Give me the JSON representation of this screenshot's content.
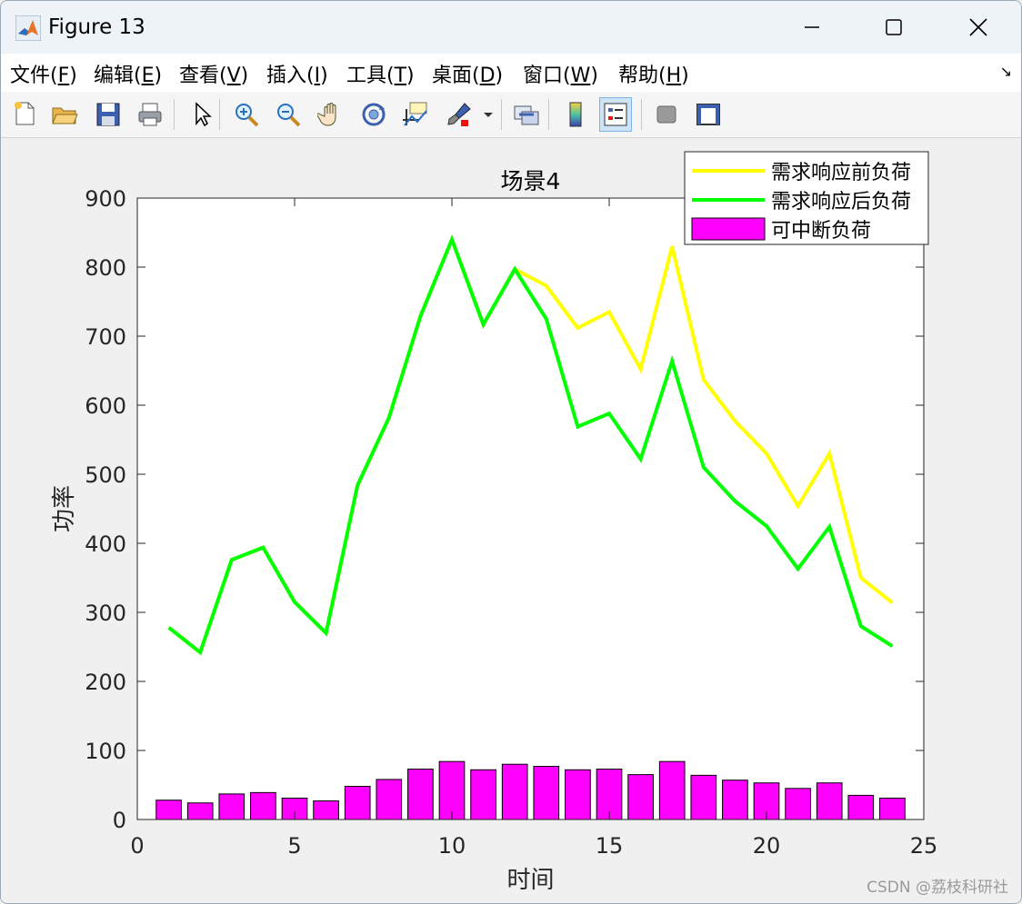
{
  "window": {
    "title": "Figure 13",
    "minimize_label": "—",
    "maximize_label": "☐",
    "close_label": "✕"
  },
  "menu": [
    {
      "label": "文件(",
      "key": "F",
      "tail": ")"
    },
    {
      "label": "编辑(",
      "key": "E",
      "tail": ")"
    },
    {
      "label": "查看(",
      "key": "V",
      "tail": ")"
    },
    {
      "label": "插入(",
      "key": "I",
      "tail": ")"
    },
    {
      "label": "工具(",
      "key": "T",
      "tail": ")"
    },
    {
      "label": "桌面(",
      "key": "D",
      "tail": ")"
    },
    {
      "label": "窗口(",
      "key": "W",
      "tail": ")"
    },
    {
      "label": "帮助(",
      "key": "H",
      "tail": ")"
    }
  ],
  "toolbar": {
    "icons": [
      "new-file-icon",
      "open-folder-icon",
      "save-icon",
      "print-icon",
      "pointer-icon",
      "zoom-in-icon",
      "zoom-out-icon",
      "pan-hand-icon",
      "rotate-3d-icon",
      "data-cursor-icon",
      "brush-icon",
      "link-plot-icon",
      "colorbar-icon",
      "legend-icon",
      "hide-plot-tools-icon",
      "show-plot-tools-icon"
    ]
  },
  "watermark": "CSDN @荔枝科研社",
  "colors": {
    "before": "#ffff00",
    "after": "#00ff00",
    "bar": "#ff00ff"
  },
  "chart_data": {
    "type": "line+bar",
    "title": "场景4",
    "xlabel": "时间",
    "ylabel": "功率",
    "xlim": [
      0,
      25
    ],
    "ylim": [
      0,
      900
    ],
    "xticks": [
      0,
      5,
      10,
      15,
      20,
      25
    ],
    "yticks": [
      0,
      100,
      200,
      300,
      400,
      500,
      600,
      700,
      800,
      900
    ],
    "x": [
      1,
      2,
      3,
      4,
      5,
      6,
      7,
      8,
      9,
      10,
      11,
      12,
      13,
      14,
      15,
      16,
      17,
      18,
      19,
      20,
      21,
      22,
      23,
      24
    ],
    "legend_position": "top-right",
    "series": [
      {
        "name": "需求响应前负荷",
        "kind": "line",
        "color": "#ffff00",
        "values": [
          278,
          242,
          376,
          394,
          315,
          270,
          484,
          582,
          729,
          840,
          717,
          797,
          773,
          712,
          735,
          652,
          830,
          637,
          577,
          530,
          454,
          530,
          350,
          314
        ]
      },
      {
        "name": "需求响应后负荷",
        "kind": "line",
        "color": "#00ff00",
        "values": [
          278,
          242,
          376,
          394,
          315,
          270,
          484,
          582,
          729,
          840,
          717,
          797,
          725,
          569,
          588,
          522,
          664,
          510,
          461,
          425,
          363,
          424,
          280,
          251
        ]
      },
      {
        "name": "可中断负荷",
        "kind": "bar",
        "color": "#ff00ff",
        "values": [
          28,
          24,
          37,
          39,
          31,
          27,
          48,
          58,
          73,
          84,
          72,
          80,
          77,
          72,
          73,
          65,
          84,
          64,
          57,
          53,
          45,
          53,
          35,
          31
        ]
      }
    ]
  }
}
